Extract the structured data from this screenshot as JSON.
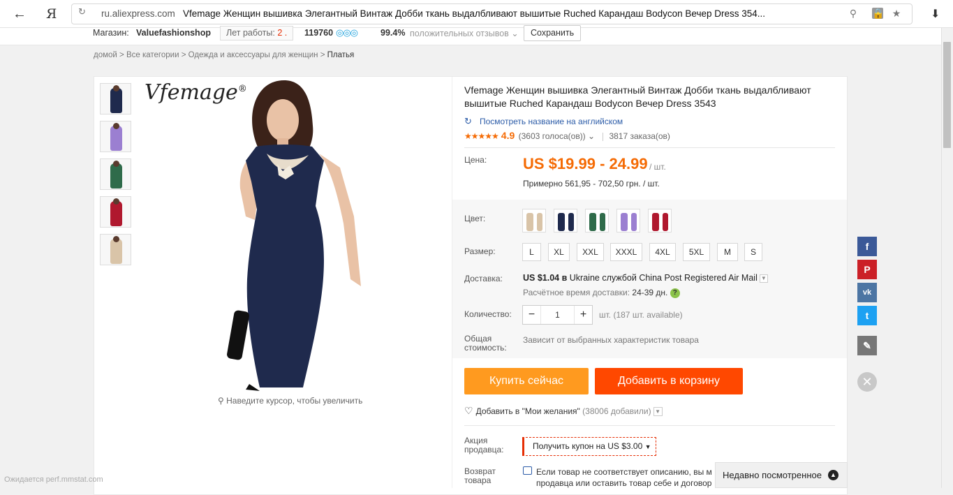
{
  "browser": {
    "back_icon": "arrow-left-icon",
    "yandex_logo": "Я",
    "url": "ru.aliexpress.com",
    "page_title": "Vfemage Женщин вышивка Элегантный Винтаж Добби ткань выдалбливают вышитые Ruched Карандаш Bodycon Вечер Dress 354...",
    "download_icon": "download-icon"
  },
  "shop": {
    "store_label": "Магазин:",
    "store_name": "Valuefashionshop",
    "years_label": "Лет работы:",
    "years_value": "2 .",
    "score": "119760",
    "medals": "◎◎◎",
    "positive_pct": "99.4%",
    "positive_label": "положительных отзывов",
    "save_label": "Сохранить"
  },
  "breadcrumb": {
    "home": "домой",
    "all": "Все категории",
    "clothes": "Одежда и аксессуары для женщин",
    "current": "Платья"
  },
  "gallery": {
    "brand": "Vfemage",
    "brand_mark": "®",
    "zoom_hint": "Наведите курсор, чтобы увеличить"
  },
  "product": {
    "title": "Vfemage Женщин вышивка Элегантный Винтаж Добби ткань выдалбливают вышитые Ruched Карандаш Bodycon Вечер Dress 3543",
    "translate": "Посмотреть название на английском",
    "stars": "★★★★★",
    "rating": "4.9",
    "votes": "(3603 голоса(ов))",
    "orders": "3817 заказа(ов)",
    "price_label": "Цена:",
    "price": "US $19.99 - 24.99",
    "price_unit": "/ шт.",
    "approx": "Примерно 561,95 - 702,50 грн. / шт.",
    "color_label": "Цвет:",
    "colors": [
      "#d9c4a8",
      "#1f2a4d",
      "#2f6b4a",
      "#9b7fd1",
      "#b0182e"
    ],
    "size_label": "Размер:",
    "sizes": [
      "L",
      "XL",
      "XXL",
      "XXXL",
      "4XL",
      "5XL",
      "M",
      "S"
    ],
    "delivery_label": "Доставка:",
    "delivery_price": "US $1.04",
    "delivery_to": "в",
    "delivery_text": "Ukraine службой China Post Registered Air Mail",
    "eta_label": "Расчётное время доставки:",
    "eta_value": "24-39 дн.",
    "qty_label": "Количество:",
    "qty_value": "1",
    "qty_avail": "шт. (187 шт. available)",
    "total_label": "Общая стоимость:",
    "total_text": "Зависит от выбранных характеристик товара",
    "buy_now": "Купить сейчас",
    "add_cart": "Добавить в корзину",
    "wishlist": "Добавить в \"Мои желания\"",
    "wishlist_count": "(38006 добавили)",
    "promo_label": "Акция продавца:",
    "coupon": "Получить купон на US $3.00",
    "return_label": "Возврат товара",
    "return_text_1": "Если товар не соответствует описанию, вы м",
    "return_text_2": "продавца или оставить товар себе и договор"
  },
  "recent": {
    "label": "Недавно посмотренное"
  },
  "social": [
    {
      "name": "facebook-icon",
      "glyph": "f",
      "color": "#3b5998"
    },
    {
      "name": "pinterest-icon",
      "glyph": "P",
      "color": "#cb2027"
    },
    {
      "name": "vk-icon",
      "glyph": "vk",
      "color": "#4c75a3"
    },
    {
      "name": "twitter-icon",
      "glyph": "t",
      "color": "#1da1f2"
    },
    {
      "name": "edit-icon",
      "glyph": "✎",
      "color": "#777777"
    }
  ],
  "status_text": "Ожидается perf.mmstat.com"
}
